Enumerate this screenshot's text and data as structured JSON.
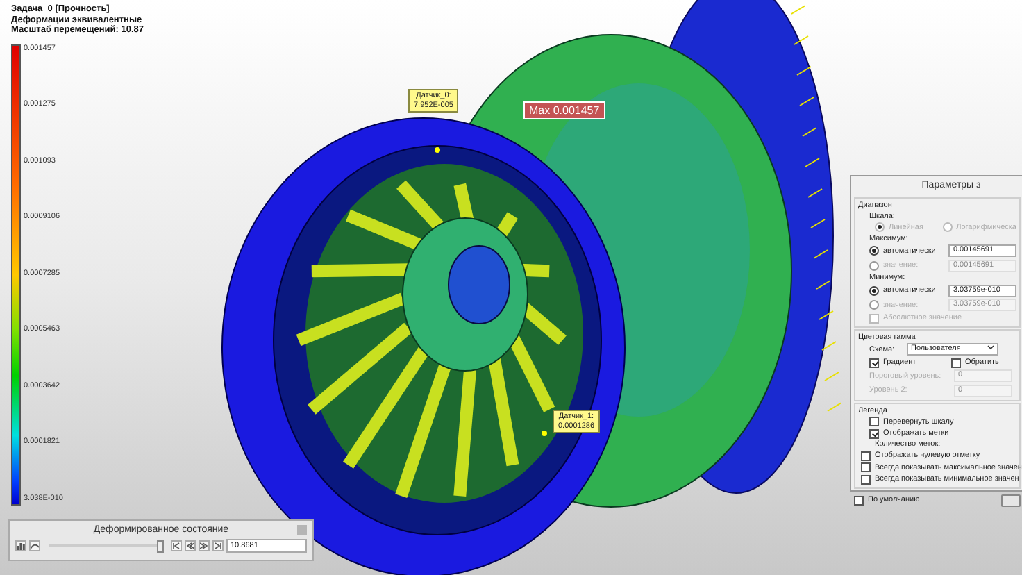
{
  "header": {
    "task": "Задача_0 [Прочность]",
    "result": "Деформации эквивалентные",
    "scale": "Масштаб перемещений: 10.87"
  },
  "legend": {
    "ticks": [
      "0.001457",
      "0.001275",
      "0.001093",
      "0.0009106",
      "0.0007285",
      "0.0005463",
      "0.0003642",
      "0.0001821",
      "3.038E-010"
    ]
  },
  "callouts": [
    {
      "kind": "sensor",
      "name": "Датчик_0:",
      "value": "7.952E-005"
    },
    {
      "kind": "max",
      "text": "Max 0.001457"
    },
    {
      "kind": "sensor",
      "name": "Датчик_1:",
      "value": "0.0001286"
    }
  ],
  "params_panel": {
    "title": "Параметры з",
    "range": {
      "title": "Диапазон",
      "scale_label": "Шкала:",
      "scale_options": [
        {
          "label": "Линейная",
          "selected": true
        },
        {
          "label": "Логарифмическа",
          "selected": false
        }
      ],
      "max_label": "Максимум:",
      "max_options": [
        {
          "label": "автоматически",
          "selected": true,
          "value": "0.00145691"
        },
        {
          "label": "значение:",
          "selected": false,
          "value": "0.00145691"
        }
      ],
      "min_label": "Минимум:",
      "min_options": [
        {
          "label": "автоматически",
          "selected": true,
          "value": "3.03759e-010"
        },
        {
          "label": "значение:",
          "selected": false,
          "value": "3.03759e-010"
        }
      ],
      "absolute": {
        "label": "Абсолютное значение",
        "checked": false,
        "disabled": true
      }
    },
    "color": {
      "title": "Цветовая гамма",
      "scheme_label": "Схема:",
      "scheme_value": "Пользователя",
      "gradient": {
        "label": "Градиент",
        "checked": true
      },
      "invert": {
        "label": "Обратить",
        "checked": false
      },
      "threshold_label": "Пороговый уровень:",
      "threshold_value": "0",
      "level2_label": "Уровень 2:",
      "level2_value": "0"
    },
    "legend": {
      "title": "Легенда",
      "options": [
        {
          "label": "Перевернуть шкалу",
          "checked": false
        },
        {
          "label": "Отображать метки",
          "checked": true
        }
      ],
      "count_label": "Количество меток:",
      "more_options": [
        {
          "label": "Отображать нулевую отметку",
          "checked": false
        },
        {
          "label": "Всегда показывать максимальное значен",
          "checked": false
        },
        {
          "label": "Всегда показывать минимальное значен",
          "checked": false
        }
      ]
    },
    "default": {
      "label": "По умолчанию",
      "checked": false
    }
  },
  "deform_panel": {
    "title": "Деформированное состояние",
    "slider": {
      "level": 0.97
    },
    "value": "10.8681"
  }
}
